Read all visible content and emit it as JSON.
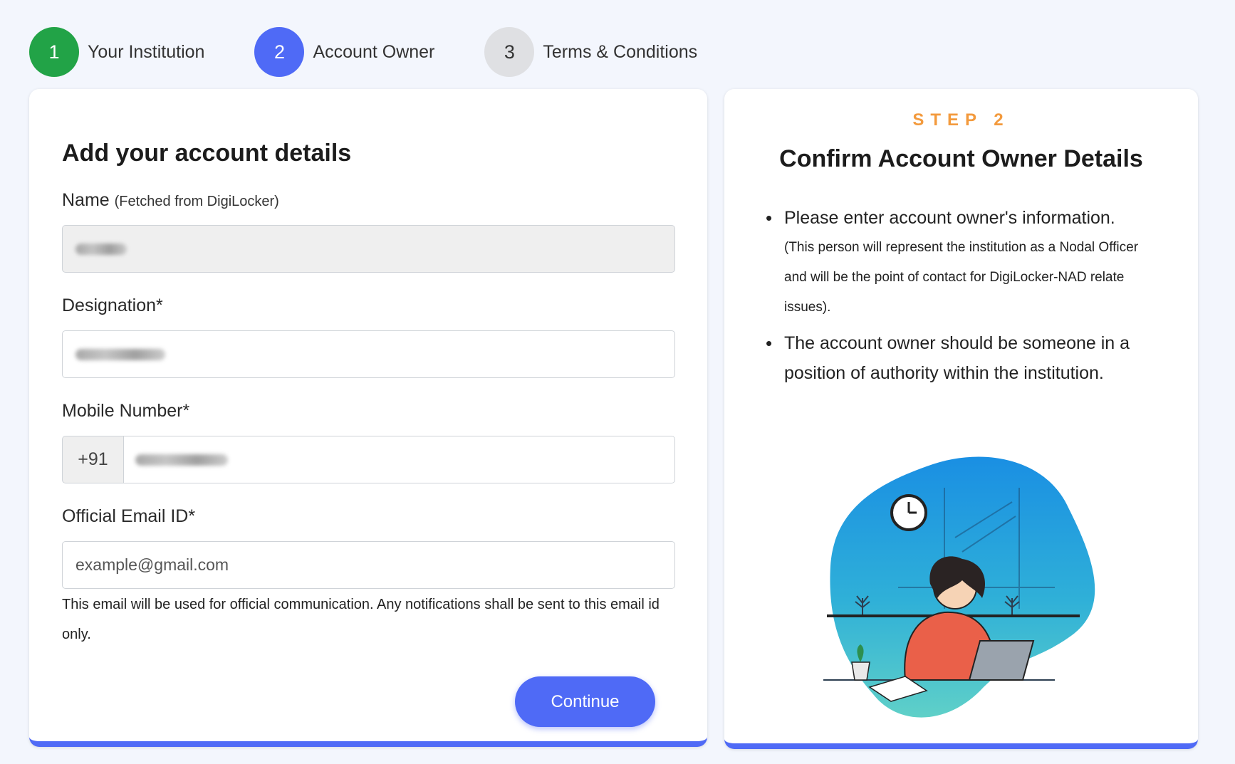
{
  "stepper": {
    "steps": [
      {
        "number": "1",
        "label": "Your Institution",
        "state": "done"
      },
      {
        "number": "2",
        "label": "Account Owner",
        "state": "active"
      },
      {
        "number": "3",
        "label": "Terms & Conditions",
        "state": "pending"
      }
    ]
  },
  "colors": {
    "done": "#22a347",
    "active": "#4f6af6",
    "pending": "#dfe0e3",
    "accent_orange": "#f39a3d"
  },
  "form": {
    "title": "Add your account details",
    "name": {
      "label": "Name",
      "sub_label": "(Fetched from DigiLocker)",
      "value_state": "blurred"
    },
    "designation": {
      "label": "Designation*",
      "value_state": "blurred"
    },
    "mobile": {
      "label": "Mobile Number*",
      "prefix": "+91",
      "value_state": "blurred"
    },
    "email": {
      "label": "Official Email ID*",
      "placeholder": "example@gmail.com",
      "value": ""
    },
    "help_text": "This email will be used for official communication. Any notifications shall be sent to this email id only.",
    "continue_label": "Continue"
  },
  "info": {
    "step_tag": "STEP 2",
    "title": "Confirm Account Owner Details",
    "bullets": [
      {
        "main": "Please enter account owner's information.",
        "sub": "(This person will represent the institution as a Nodal Officer and will be the point of contact for DigiLocker-NAD relate issues)."
      },
      {
        "main": "The account owner should be someone in a position of authority within the institution.",
        "sub": ""
      }
    ],
    "illustration_icon": "woman-working-at-desk-illustration"
  }
}
